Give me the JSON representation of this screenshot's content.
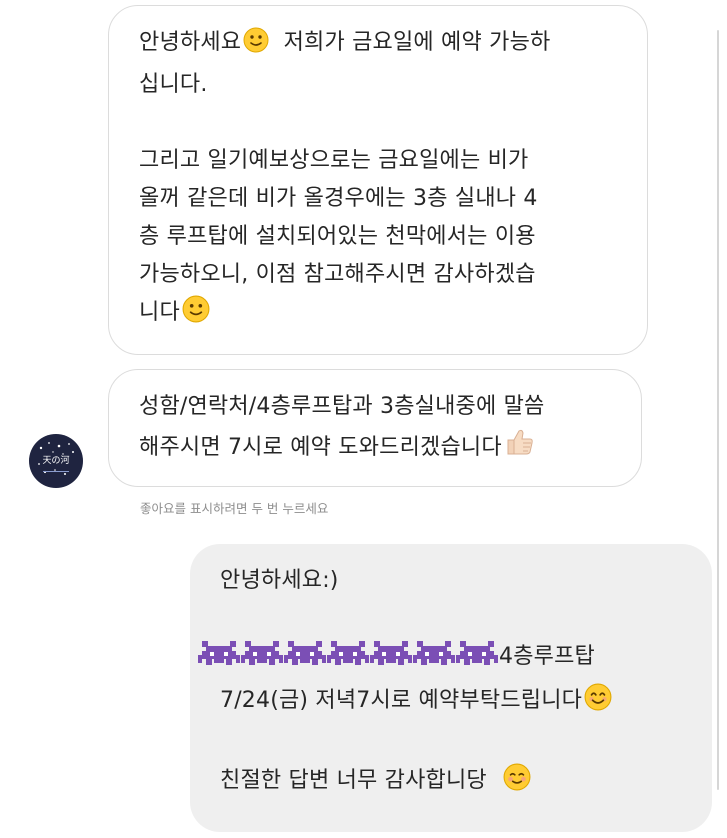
{
  "chat": {
    "incoming_1": {
      "lines": [
        "안녕하세요",
        "저희가 금요일에 예약 가능하",
        "십니다.",
        "그리고 일기예보상으로는 금요일에는 비가",
        "올꺼 같은데 비가 올경우에는 3층 실내나 4",
        "층 루프탑에 설치되어있는 천막에서는 이용",
        "가능하오니, 이점 참고해주시면 감사하겠습",
        "니다"
      ],
      "emojis": [
        "slightly-smiling-face",
        "slightly-smiling-face"
      ]
    },
    "incoming_2": {
      "lines": [
        "성함/연락처/4층루프탑과 3층실내중에 말씀",
        "해주시면 7시로 예약 도와드리겠습니다"
      ],
      "emoji": "thumbs-up"
    },
    "avatar_text": "天の河",
    "like_hint": "좋아요를 표시하려면 두 번 누르세요",
    "outgoing": {
      "lines": [
        "안녕하세요:)",
        "4층루프탑",
        "7/24(금) 저녁7시로 예약부탁드립니다",
        "친절한 답변 너무 감사합니당"
      ],
      "emojis": [
        "alien-monster",
        "smiling-face-with-smiling-eyes",
        "smiling-face"
      ]
    }
  },
  "colors": {
    "incoming_bg": "#ffffff",
    "incoming_border": "#dcdcdc",
    "outgoing_bg": "#efefef",
    "text": "#262626",
    "hint": "#8e8e8e",
    "emoji_yellow": "#ffcc33",
    "alien_purple": "#7b4fb5"
  }
}
